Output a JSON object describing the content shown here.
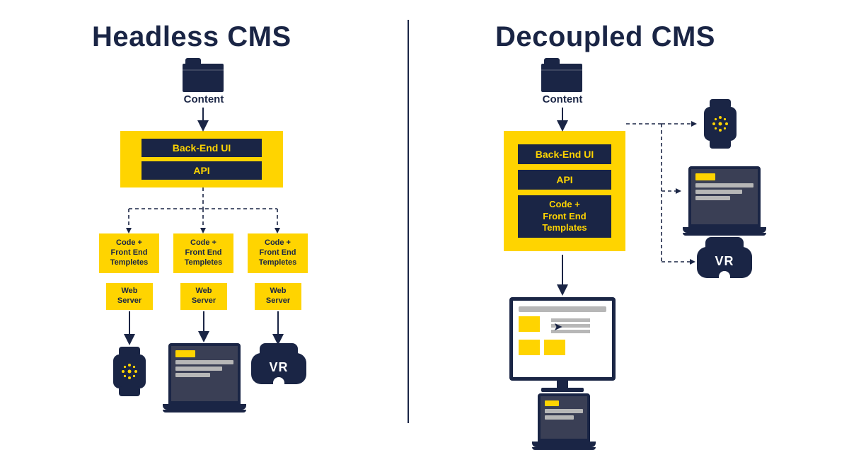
{
  "colors": {
    "navy": "#1a2545",
    "yellow": "#ffd400"
  },
  "headless": {
    "title": "Headless CMS",
    "content_label": "Content",
    "backend": {
      "ui": "Back-End UI",
      "api": "API"
    },
    "columns": [
      {
        "template": "Code +\nFront End\nTempletes",
        "server": "Web\nServer",
        "device": "watch"
      },
      {
        "template": "Code +\nFront End\nTempletes",
        "server": "Web\nServer",
        "device": "laptop"
      },
      {
        "template": "Code +\nFront End\nTempletes",
        "server": "Web\nServer",
        "device": "vr"
      }
    ],
    "vr_label": "VR"
  },
  "decoupled": {
    "title": "Decoupled CMS",
    "content_label": "Content",
    "backend": {
      "ui": "Back-End UI",
      "api": "API",
      "templates": "Code +\nFront End\nTemplates"
    },
    "primary_devices": [
      "monitor",
      "laptop"
    ],
    "side_devices": [
      "watch",
      "laptop",
      "vr"
    ],
    "vr_label": "VR"
  }
}
